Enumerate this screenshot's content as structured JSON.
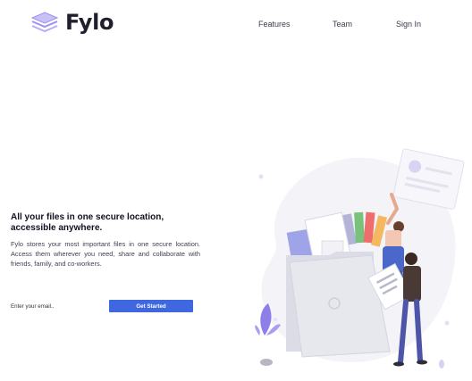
{
  "header": {
    "logo_text": "Fylo",
    "nav": [
      {
        "label": "Features"
      },
      {
        "label": "Team"
      },
      {
        "label": "Sign In"
      }
    ]
  },
  "hero": {
    "title": "All your files in one secure location, accessible anywhere.",
    "description": "Fylo stores your most important files in one secure location. Access them wherever you need, share and collaborate with friends, family, and co-workers.",
    "email_placeholder": "Enter your email..",
    "cta_label": "Get Started"
  },
  "colors": {
    "primary_button": "#3f67e0",
    "logo_accent": "#9d8ff0",
    "text_dark": "#1f1f2e"
  },
  "icons": [
    "layered-stack-logo-icon",
    "hero-illustration"
  ]
}
